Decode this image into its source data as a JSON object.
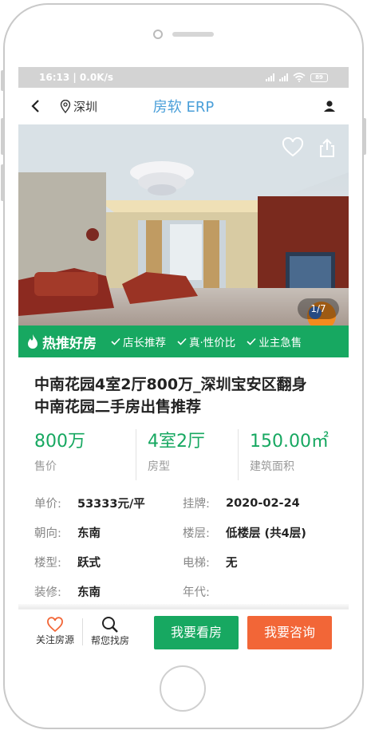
{
  "statusbar": {
    "time_speed": "16:13 | 0.0K/s",
    "battery": "89"
  },
  "navbar": {
    "city": "深圳",
    "title": "房软 ERP"
  },
  "hero": {
    "pager": "1/7"
  },
  "hot": {
    "title": "热推好房",
    "tags": [
      "店长推荐",
      "真·性价比",
      "业主急售"
    ]
  },
  "house": {
    "title_line1": "中南花园4室2厅800万_深圳宝安区翻身",
    "title_line2": "中南花园二手房出售推荐"
  },
  "stats": [
    {
      "value": "800万",
      "label": "售价"
    },
    {
      "value": "4室2厅",
      "label": "房型"
    },
    {
      "value": "150.00㎡",
      "label": "建筑面积"
    }
  ],
  "info": [
    {
      "key": "单价:",
      "value": "53333元/平"
    },
    {
      "key": "挂牌:",
      "value": "2020-02-24"
    },
    {
      "key": "朝向:",
      "value": "东南"
    },
    {
      "key": "楼层:",
      "value": "低楼层 (共4层)"
    },
    {
      "key": "楼型:",
      "value": "跃式"
    },
    {
      "key": "电梯:",
      "value": "无"
    },
    {
      "key": "装修:",
      "value": "东南"
    },
    {
      "key": "年代:",
      "value": ""
    }
  ],
  "bottom": {
    "follow_label": "关注房源",
    "find_label": "帮您找房",
    "view_label": "我要看房",
    "consult_label": "我要咨询"
  },
  "colors": {
    "brand_green": "#17a861",
    "accent_orange": "#f26637",
    "title_blue": "#4a9fd9"
  }
}
